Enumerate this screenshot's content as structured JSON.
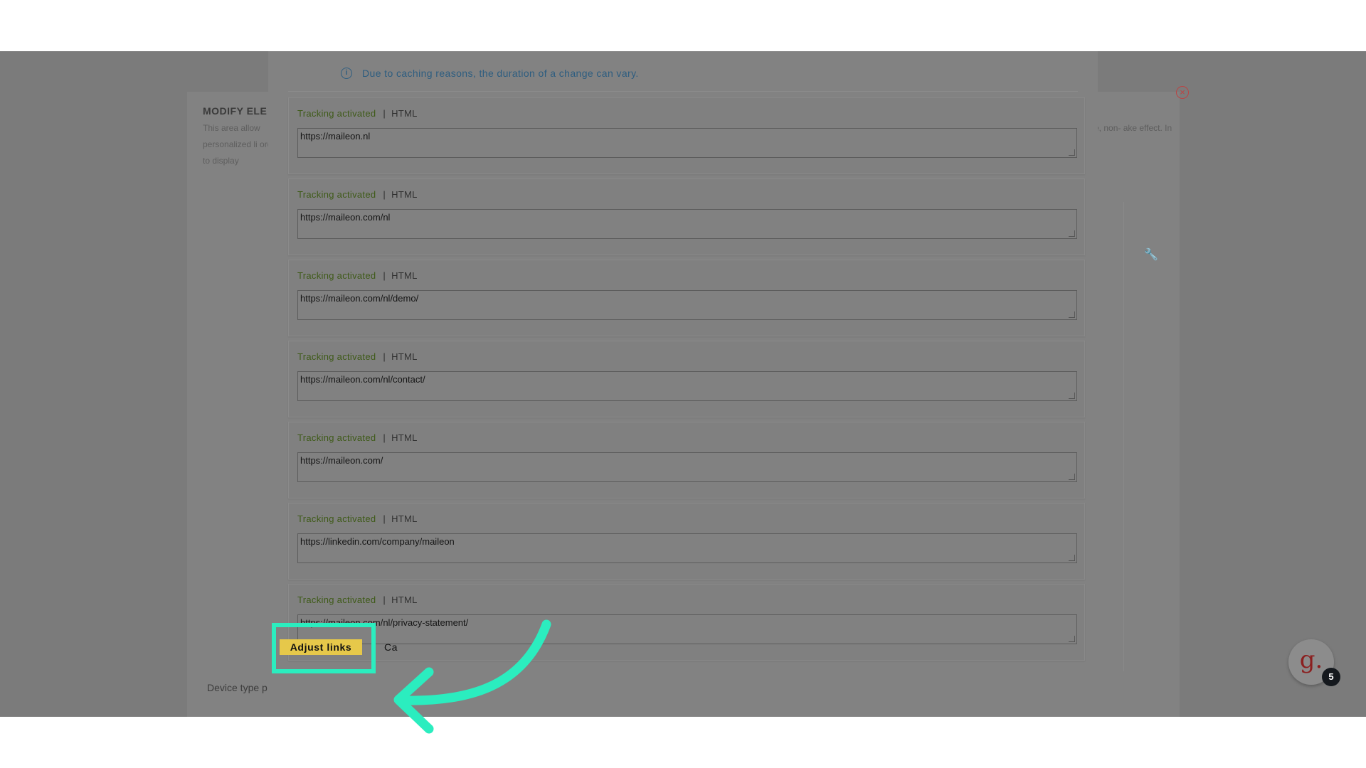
{
  "background_panel": {
    "title": "MODIFY ELE",
    "description": "This area allow personalized li order to display",
    "description_right": "e, non- ake effect. In",
    "footer_label": "Device type p",
    "close_icon": "close-icon",
    "wrench_icon": "wrench-icon"
  },
  "modal": {
    "info_icon": "info-icon",
    "info_text": "Due to caching reasons, the duration of a change can vary.",
    "links": [
      {
        "tracking": "Tracking activated",
        "separator": "|",
        "format": "HTML",
        "url": "https://maileon.nl"
      },
      {
        "tracking": "Tracking activated",
        "separator": "|",
        "format": "HTML",
        "url": "https://maileon.com/nl"
      },
      {
        "tracking": "Tracking activated",
        "separator": "|",
        "format": "HTML",
        "url": "https://maileon.com/nl/demo/"
      },
      {
        "tracking": "Tracking activated",
        "separator": "|",
        "format": "HTML",
        "url": "https://maileon.com/nl/contact/"
      },
      {
        "tracking": "Tracking activated",
        "separator": "|",
        "format": "HTML",
        "url": "https://maileon.com/"
      },
      {
        "tracking": "Tracking activated",
        "separator": "|",
        "format": "HTML",
        "url": "https://linkedin.com/company/maileon"
      },
      {
        "tracking": "Tracking activated",
        "separator": "|",
        "format": "HTML",
        "url": "https://maileon.com/nl/privacy-statement/"
      }
    ],
    "adjust_button": "Adjust links",
    "cancel_button": "Ca"
  },
  "avatar": {
    "letter": "g.",
    "badge_count": "5"
  },
  "colors": {
    "highlight": "#2bedbf",
    "button": "#e6c84a",
    "tracking_text": "#3e5a17",
    "info_text": "#2d5d80",
    "overlay": "#7b7b7b"
  }
}
